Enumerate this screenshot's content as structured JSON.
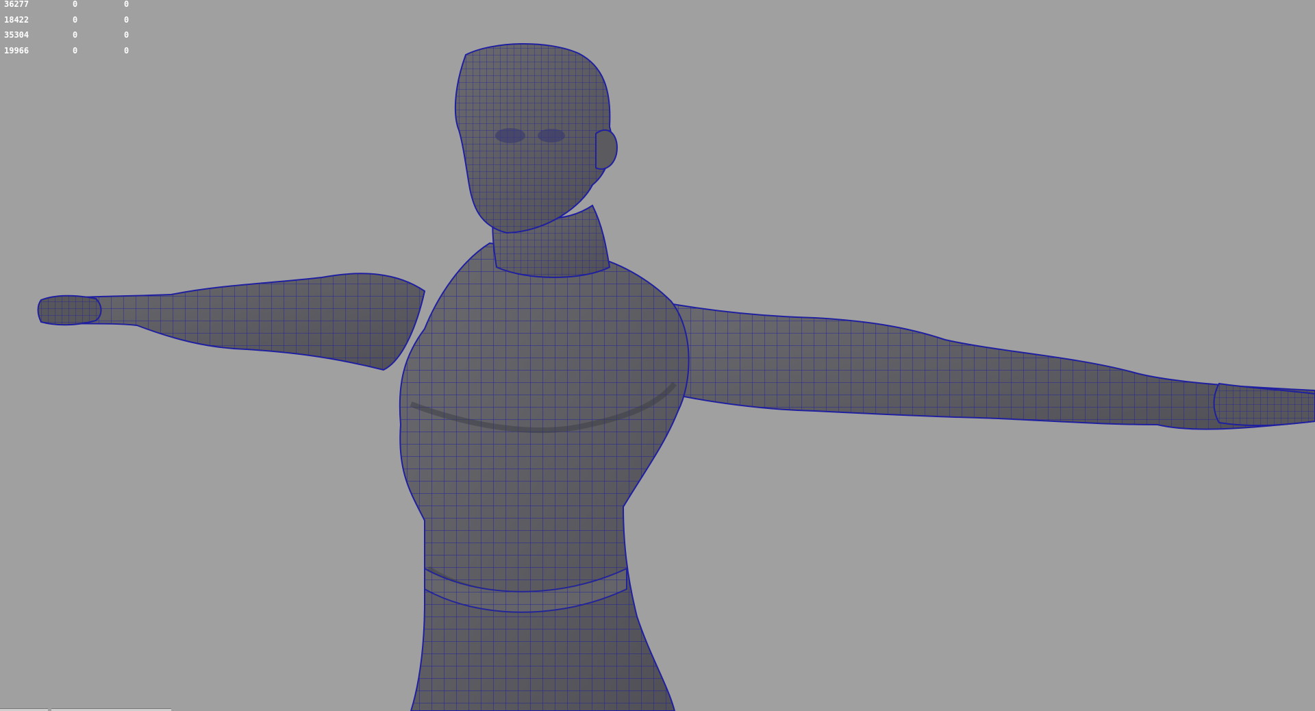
{
  "hud": {
    "rows": [
      [
        "36277",
        "0",
        "0"
      ],
      [
        "18422",
        "0",
        "0"
      ],
      [
        "35304",
        "0",
        "0"
      ],
      [
        "19966",
        "0",
        "0"
      ]
    ]
  },
  "scene": {
    "background": "#a0a0a0",
    "mesh_fill": "#5f5f63",
    "mesh_shadow": "#4b4b50",
    "wireframe": "#1f1fa0"
  }
}
